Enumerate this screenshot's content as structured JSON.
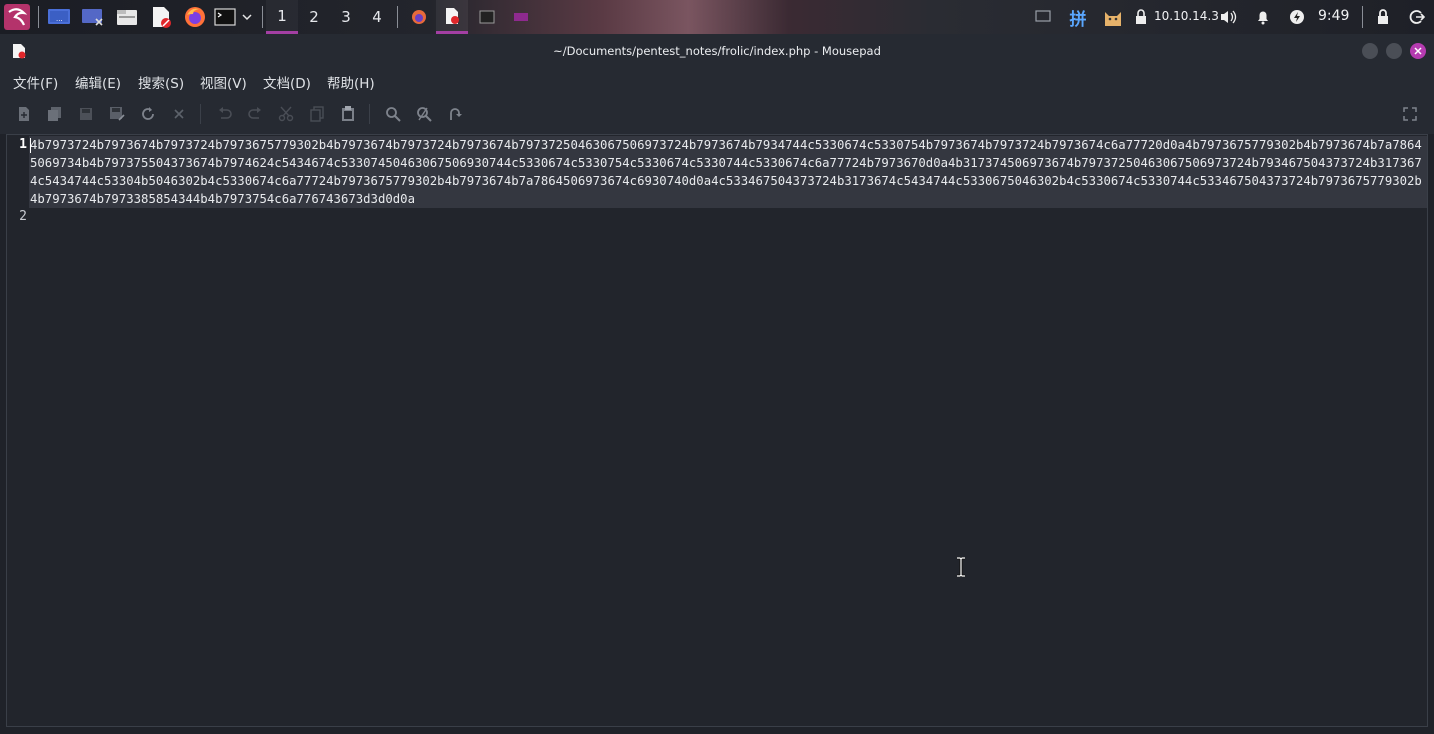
{
  "panel": {
    "workspaces": [
      "1",
      "2",
      "3",
      "4"
    ],
    "active_workspace": "1",
    "ime_label": "拼",
    "ip_address": "10.10.14.3",
    "clock": "9:49",
    "icons": [
      "kali-menu-icon",
      "desktop-icon",
      "screen-icon",
      "file-manager-icon",
      "text-editor-icon",
      "firefox-icon",
      "terminal-icon",
      "chevron-down-icon",
      "firefox-task-icon",
      "mousepad-task-icon",
      "terminal-task-icon",
      "app-task-icon",
      "display-icon",
      "ime-icon",
      "cat-icon",
      "vpn-lock-icon",
      "volume-icon",
      "bell-icon",
      "power-icon",
      "lock-icon",
      "logout-icon"
    ],
    "accent_color": "#a33fa3"
  },
  "window": {
    "title": "~/Documents/pentest_notes/frolic/index.php - Mousepad"
  },
  "menu": {
    "file": "文件(F)",
    "edit": "编辑(E)",
    "search": "搜索(S)",
    "view": "视图(V)",
    "document": "文档(D)",
    "help": "帮助(H)"
  },
  "toolbar": {
    "icons": [
      "new-file-icon",
      "new-window-icon",
      "save-icon",
      "save-as-icon",
      "reload-icon",
      "close-icon",
      "undo-icon",
      "redo-icon",
      "cut-icon",
      "copy-icon",
      "paste-icon",
      "find-icon",
      "find-replace-icon",
      "goto-icon",
      "fullscreen-icon"
    ]
  },
  "editor": {
    "line_numbers": [
      "1",
      "2"
    ],
    "line1": "4b7973724b7973674b7973724b7973675779302b4b7973674b7973724b7973674b79737250463067506973724b7973674b7934744c5330674c5330754b7973674b7973724b7973674c6a77720d0a4b7973675779302b4b7973674b7a78645069734b4b797375504373674b7974624c5434674c53307450463067506930744c5330674c5330754c5330674c5330744c5330674c6a77724b7973670d0a4b317374506973674b79737250463067506973724b793467504373724b3173674c5434744c53304b5046302b4c5330674c6a77724b7973675779302b4b7973674b7a7864506973674c6930740d0a4c533467504373724b3173674c5434744c5330675046302b4c5330674c5330744c533467504373724b7973675779302b4b7973674b7973385854344b4b7973754c6a776743673d3d0d0a",
    "line2": ""
  }
}
